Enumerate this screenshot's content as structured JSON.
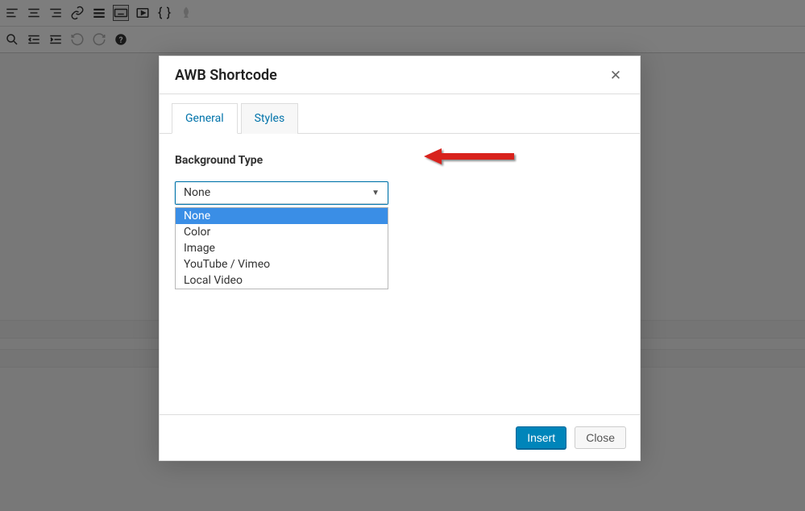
{
  "modal": {
    "title": "AWB Shortcode",
    "tabs": {
      "general": "General",
      "styles": "Styles"
    },
    "field_label": "Background Type",
    "select": {
      "value": "None",
      "options": [
        "None",
        "Color",
        "Image",
        "YouTube / Vimeo",
        "Local Video"
      ]
    },
    "buttons": {
      "insert": "Insert",
      "close": "Close"
    }
  }
}
